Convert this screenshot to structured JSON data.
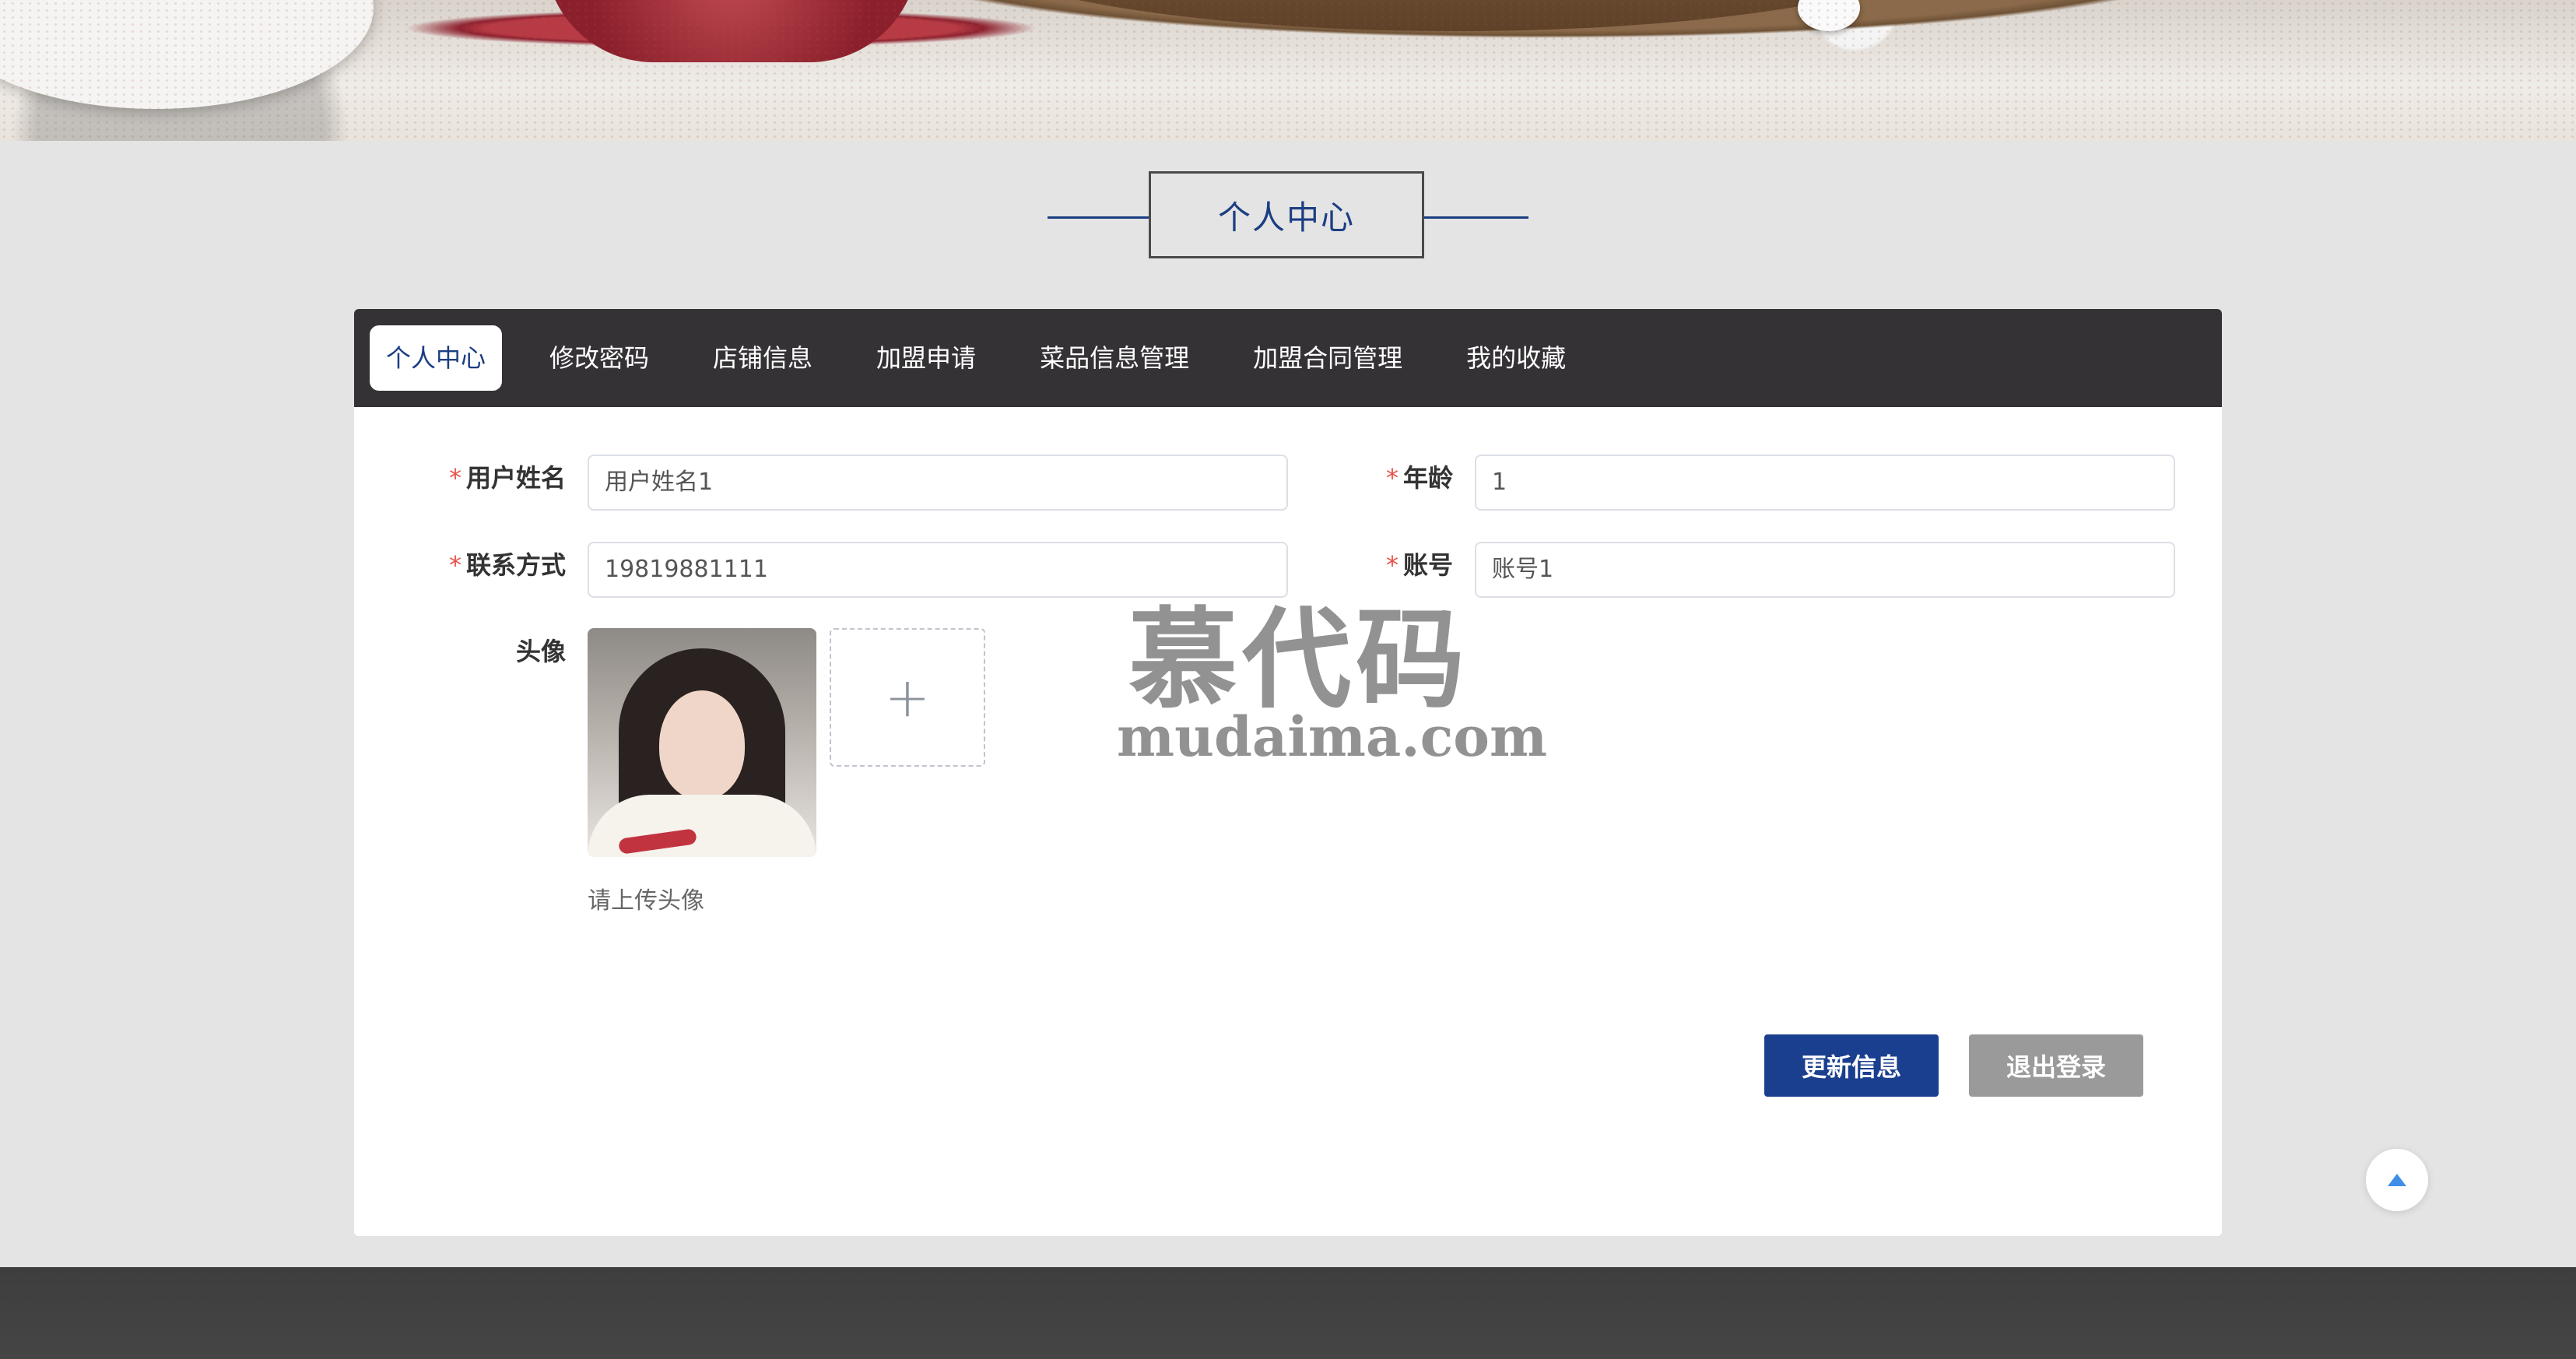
{
  "section_title": "个人中心",
  "tabs": [
    {
      "label": "个人中心",
      "active": true
    },
    {
      "label": "修改密码"
    },
    {
      "label": "店铺信息"
    },
    {
      "label": "加盟申请"
    },
    {
      "label": "菜品信息管理"
    },
    {
      "label": "加盟合同管理"
    },
    {
      "label": "我的收藏"
    }
  ],
  "form": {
    "username": {
      "label": "用户姓名",
      "value": "用户姓名1",
      "required": "*"
    },
    "age": {
      "label": "年龄",
      "value": "1",
      "required": "*"
    },
    "contact": {
      "label": "联系方式",
      "value": "19819881111",
      "required": "*"
    },
    "account": {
      "label": "账号",
      "value": "账号1",
      "required": "*"
    },
    "avatar": {
      "label": "头像",
      "hint": "请上传头像",
      "upload_icon": "plus-icon"
    }
  },
  "buttons": {
    "update": "更新信息",
    "logout": "退出登录"
  },
  "watermark": {
    "cn": "慕代码",
    "en": "mudaima.com"
  },
  "back_to_top_icon": "arrow-up-icon",
  "colors": {
    "accent": "#1a3f8f",
    "tab_bar": "#353235",
    "required": "#e8524a",
    "logout": "#9a9a9a"
  }
}
